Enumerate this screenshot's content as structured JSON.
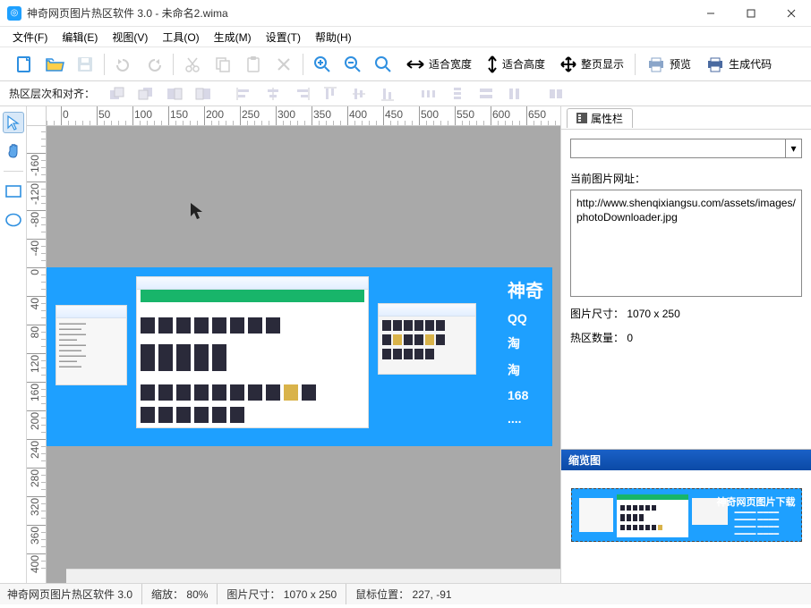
{
  "title": "神奇网页图片热区软件 3.0  -  未命名2.wima",
  "menus": {
    "file": "文件(F)",
    "edit": "编辑(E)",
    "view": "视图(V)",
    "tool": "工具(O)",
    "build": "生成(M)",
    "settings": "设置(T)",
    "help": "帮助(H)"
  },
  "toolbar": {
    "fit_width": "适合宽度",
    "fit_height": "适合高度",
    "fit_page": "整页显示",
    "preview": "预览",
    "gen_code": "生成代码"
  },
  "align_label": "热区层次和对齐：",
  "left_tools": {
    "select": "select",
    "hand": "hand",
    "rect": "rect",
    "ellipse": "ellipse"
  },
  "banner": {
    "big_text_1": "神奇",
    "lines": [
      "QQ",
      "淘",
      "淘",
      "168",
      "...."
    ]
  },
  "panel": {
    "tab": "属性栏",
    "url_label": "当前图片网址：",
    "url_value": "http://www.shenqixiangsu.com/assets/images/photoDownloader.jpg",
    "img_size_label": "图片尺寸：",
    "img_size_value": "1070 x 250",
    "hot_count_label": "热区数量：",
    "hot_count_value": "0",
    "thumb_header": "缩览图",
    "thumb_title": "神奇网页图片下载"
  },
  "status": {
    "app": "神奇网页图片热区软件 3.0",
    "zoom_label": "缩放：",
    "zoom_value": "80%",
    "size_label": "图片尺寸：",
    "size_value": "1070 x 250",
    "mouse_label": "鼠标位置：",
    "mouse_value": "227, -91"
  },
  "ruler_h_ticks": [
    0,
    100,
    150,
    200,
    250,
    300,
    350,
    400,
    450,
    500,
    550,
    600,
    650
  ]
}
